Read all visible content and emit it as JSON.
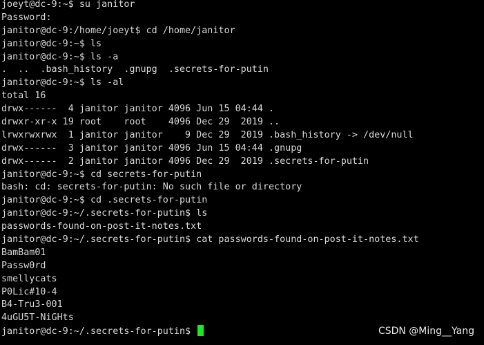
{
  "terminal": {
    "lines": [
      "joeyt@dc-9:~$ su janitor",
      "Password:",
      "janitor@dc-9:/home/joeyt$ cd /home/janitor",
      "janitor@dc-9:~$ ls",
      "janitor@dc-9:~$ ls -a",
      ".  ..  .bash_history  .gnupg  .secrets-for-putin",
      "janitor@dc-9:~$ ls -al",
      "total 16",
      "drwx------  4 janitor janitor 4096 Jun 15 04:44 .",
      "drwxr-xr-x 19 root    root    4096 Dec 29  2019 ..",
      "lrwxrwxrwx  1 janitor janitor    9 Dec 29  2019 .bash_history -> /dev/null",
      "drwx------  3 janitor janitor 4096 Jun 15 04:44 .gnupg",
      "drwx------  2 janitor janitor 4096 Dec 29  2019 .secrets-for-putin",
      "janitor@dc-9:~$ cd secrets-for-putin",
      "bash: cd: secrets-for-putin: No such file or directory",
      "janitor@dc-9:~$ cd .secrets-for-putin",
      "janitor@dc-9:~/.secrets-for-putin$ ls",
      "passwords-found-on-post-it-notes.txt",
      "janitor@dc-9:~/.secrets-for-putin$ cat passwords-found-on-post-it-notes.txt",
      "BamBam01",
      "Passw0rd",
      "smellycats",
      "P0Lic#10-4",
      "B4-Tru3-001",
      "4uGU5T-NiGHts"
    ],
    "prompt": "janitor@dc-9:~/.secrets-for-putin$ ",
    "colors": {
      "background": "#000000",
      "text": "#d9d9d9",
      "cursor": "#1ee81e"
    }
  },
  "watermark": "CSDN @Ming__Yang"
}
